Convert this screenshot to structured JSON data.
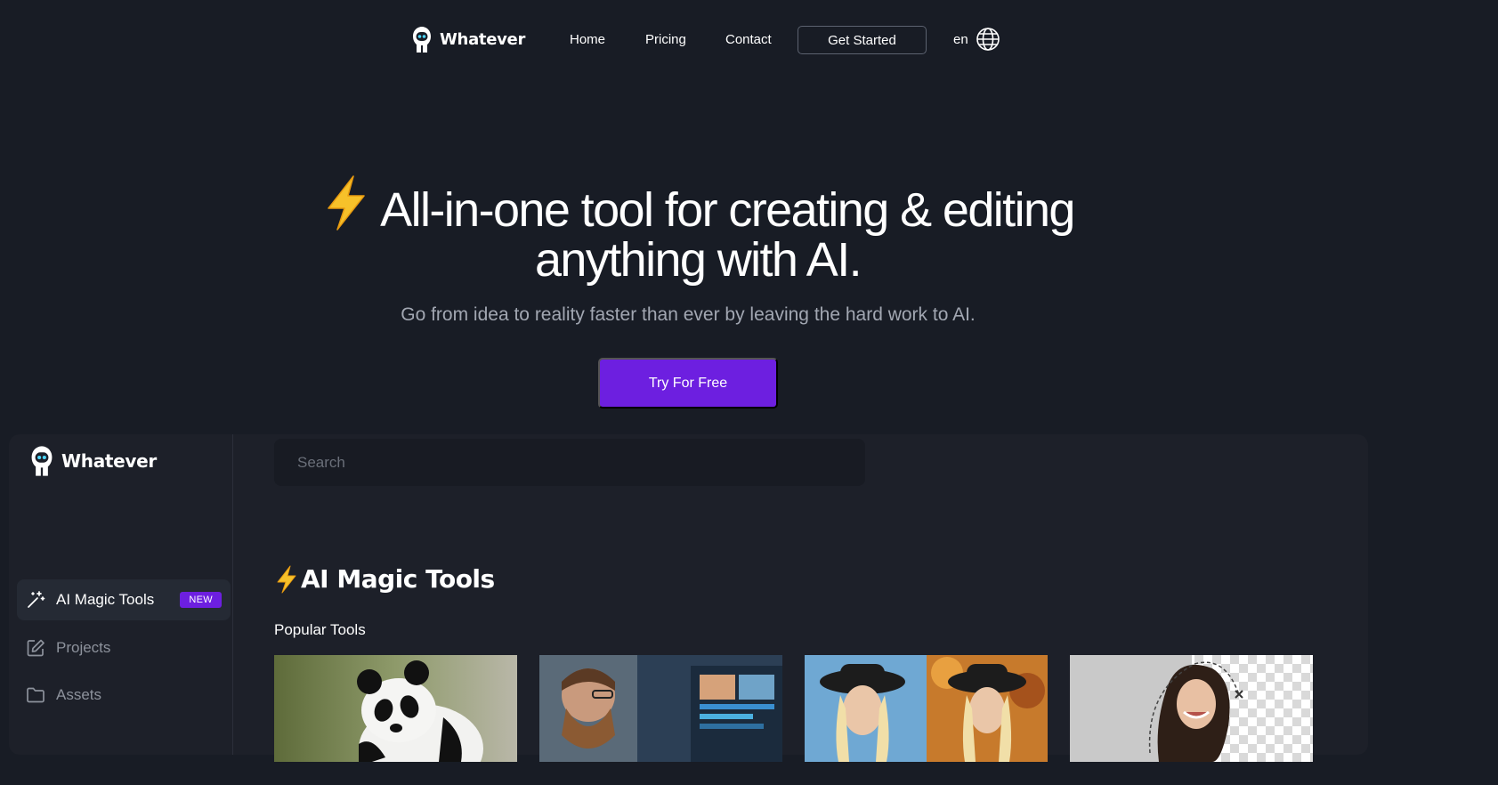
{
  "brand": {
    "name": "Whatever"
  },
  "nav": {
    "home": "Home",
    "pricing": "Pricing",
    "contact": "Contact",
    "get_started": "Get Started",
    "lang": "en"
  },
  "hero": {
    "title_line1": "All-in-one tool for creating & editing",
    "title_line2": "anything with AI.",
    "subtitle": "Go from idea to reality faster than ever by leaving the hard work to AI.",
    "cta": "Try For Free"
  },
  "app": {
    "brand_name": "Whatever",
    "search_placeholder": "Search",
    "sidebar": {
      "items": [
        {
          "label": "AI Magic Tools",
          "badge": "NEW",
          "icon": "magic-wand-icon",
          "active": true
        },
        {
          "label": "Projects",
          "icon": "edit-icon",
          "active": false
        },
        {
          "label": "Assets",
          "icon": "folder-icon",
          "active": false
        }
      ]
    },
    "section_title": "AI Magic Tools",
    "popular_label": "Popular Tools"
  },
  "colors": {
    "background": "#181c25",
    "panel": "#1d2029",
    "accent": "#6d1fe0",
    "muted_text": "#a2a7b2"
  }
}
